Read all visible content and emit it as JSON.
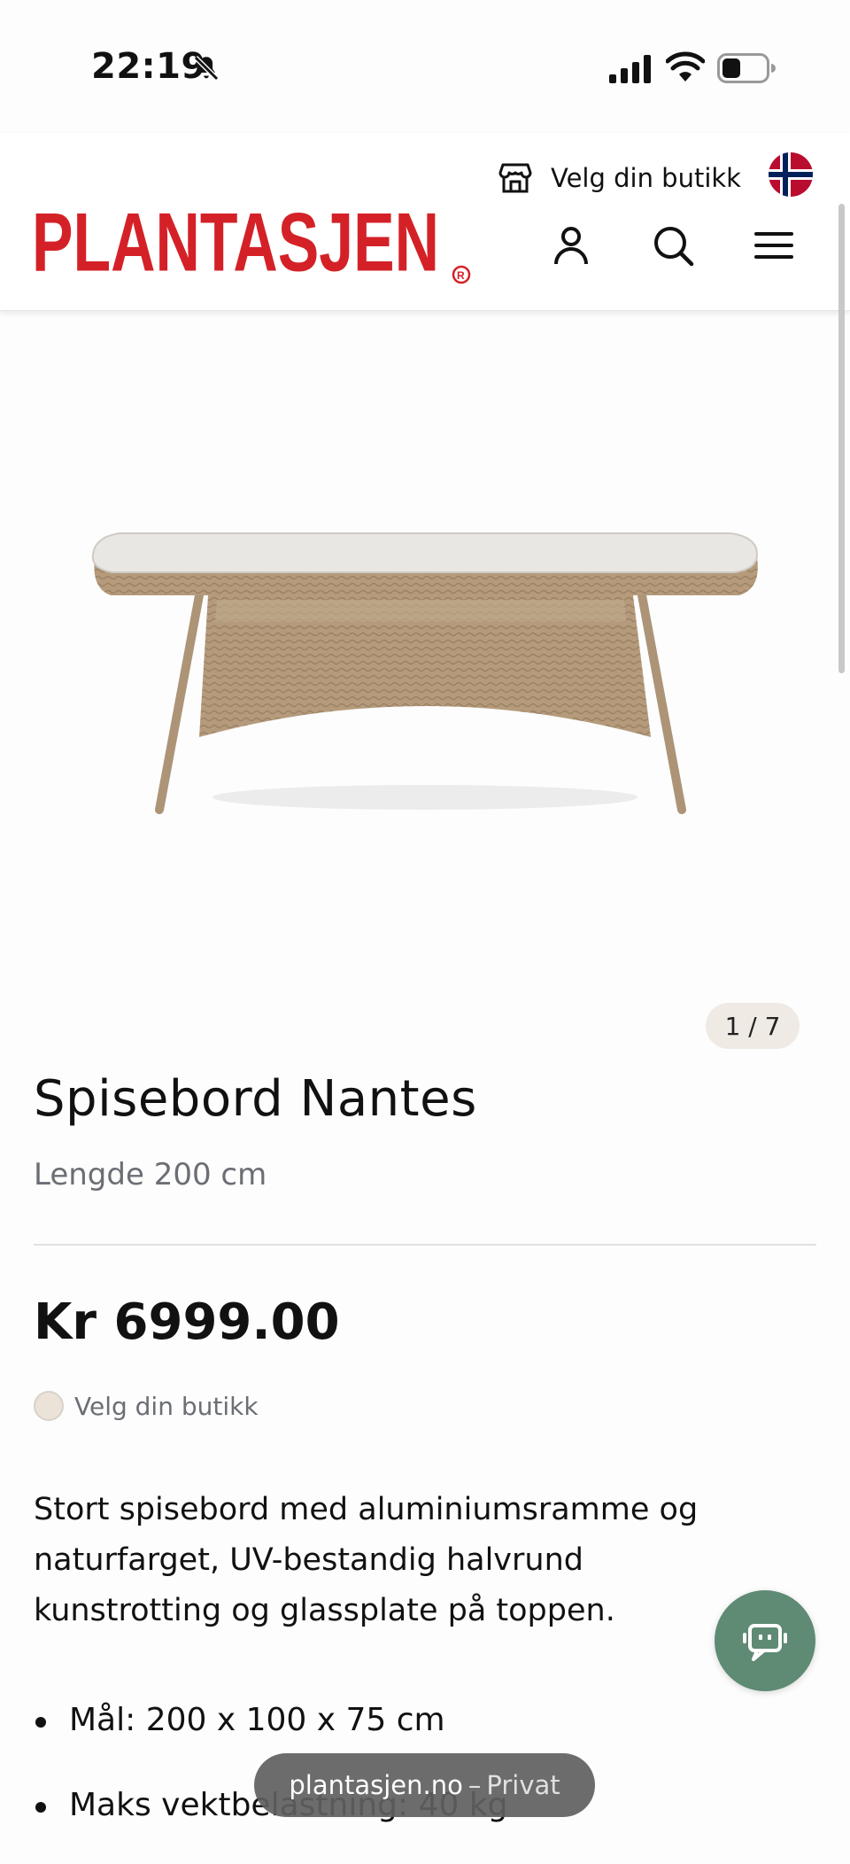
{
  "status_bar": {
    "time": "22:19"
  },
  "header": {
    "store_label": "Velg din butikk",
    "logo_text": "PLANTASJEN",
    "logo_reg": "®",
    "brand_red": "#d42127",
    "icons": [
      "store-icon",
      "norway-flag-icon",
      "user-icon",
      "search-icon",
      "menu-icon"
    ]
  },
  "gallery": {
    "counter": "1 / 7"
  },
  "product": {
    "title": "Spisebord Nantes",
    "subtitle": "Lengde 200 cm",
    "price": "Kr 6999.00",
    "store_select_label": "Velg din butikk",
    "description": "Stort spisebord med aluminiumsramme og naturfarget, UV-bestandig halvrund kunstrotting og glassplate på toppen.",
    "features": [
      "Mål: 200 x 100 x 75 cm",
      "Maks vektbelastning: 40 kg"
    ]
  },
  "chat": {
    "icon": "chat-bot-icon",
    "accent": "#5f8a73"
  },
  "browser": {
    "host": "plantasjen.no",
    "separator": "–",
    "mode": "Privat"
  }
}
